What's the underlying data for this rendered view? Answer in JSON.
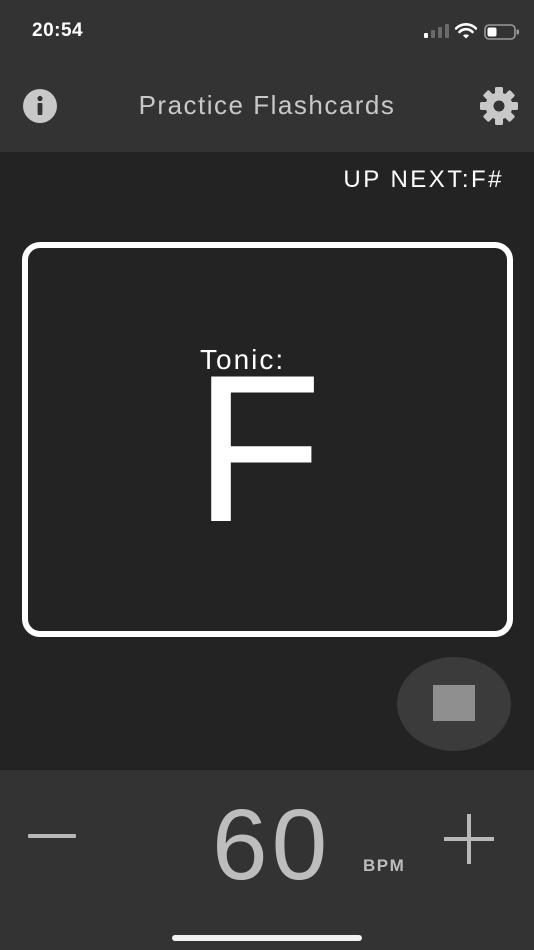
{
  "status_bar": {
    "time": "20:54",
    "icons": [
      "signal-icon",
      "wifi-icon",
      "battery-icon"
    ]
  },
  "nav": {
    "title": "Practice Flashcards",
    "left_icon": "info-icon",
    "right_icon": "gear-icon"
  },
  "up_next": {
    "text": "UP NEXT:F#"
  },
  "card": {
    "label": "Tonic:",
    "value": "F"
  },
  "controls": {
    "stop_icon": "stop-icon"
  },
  "tempo": {
    "value": "60",
    "unit": "BPM",
    "decrement_icon": "minus-icon",
    "increment_icon": "plus-icon"
  },
  "colors": {
    "background": "#232323",
    "bar": "#333333",
    "card_border": "#ffffff",
    "muted_text": "#bdbdbd"
  }
}
